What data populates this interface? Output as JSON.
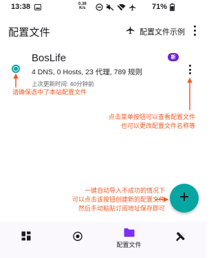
{
  "status_bar": {
    "time": "13:38",
    "net_speed_value": "0.38",
    "net_speed_unit": "K/s",
    "battery_percent": "71%",
    "icons": [
      "gallery-icon",
      "dnd-icon",
      "mute-icon",
      "wifi-icon",
      "airplane-icon",
      "battery-icon"
    ]
  },
  "app_bar": {
    "title": "配置文件",
    "sample_label": "配置文件示例",
    "sample_icon": "airplane-icon",
    "more_icon": "more-vert-icon"
  },
  "profile": {
    "name": "BosLife",
    "badge": "新",
    "stats": "4 DNS, 0 Hosts, 23 代理, 789 规则",
    "updated": "上次更新时间: 40分钟前",
    "selected": true
  },
  "annotations": {
    "select_hint": "请确保选中了本站配置文件",
    "menu_hint_line1": "点击菜单按钮可以查看配置文件",
    "menu_hint_line2": "也可以更改配置文件名称等",
    "fab_hint_line1": "一键自动导入不成功的情况下",
    "fab_hint_line2": "可以点击该按钮创建新的配置文件",
    "fab_hint_line3": "然后手动粘贴订阅地址保存即可"
  },
  "fab": {
    "icon": "plus-icon"
  },
  "bottom_nav": {
    "items": [
      {
        "label": "",
        "icon": "dashboard-icon",
        "active": false
      },
      {
        "label": "",
        "icon": "target-icon",
        "active": false
      },
      {
        "label": "配置文件",
        "icon": "folder-icon",
        "active": true
      },
      {
        "label": "",
        "icon": "tools-icon",
        "active": false
      }
    ]
  },
  "colors": {
    "accent": "#08a6a2",
    "annotation": "#f05a24",
    "badge": "#6a24d8",
    "nav_active": "#7b2ff7"
  }
}
